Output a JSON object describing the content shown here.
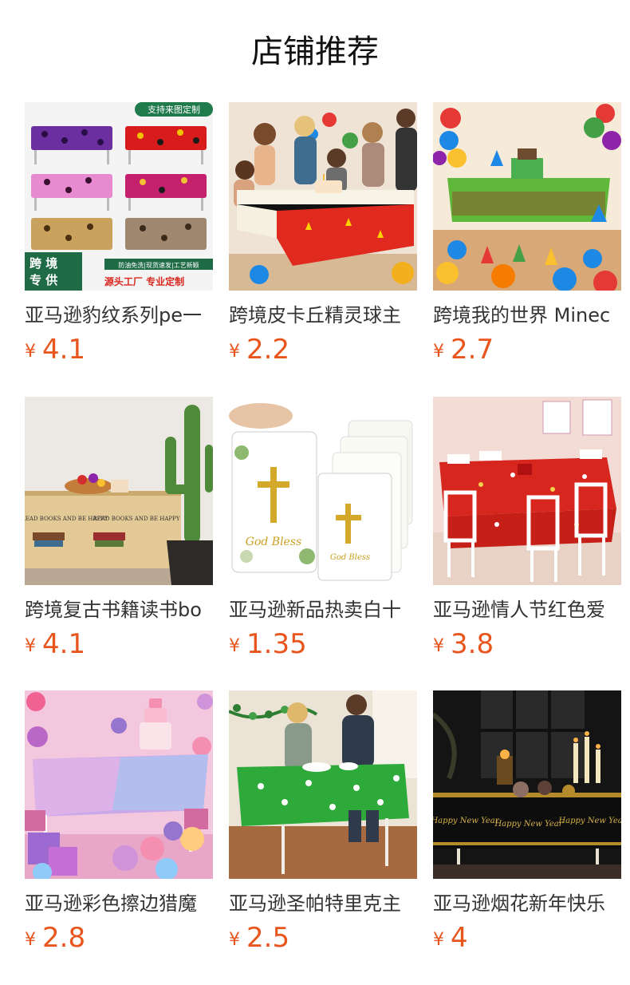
{
  "page": {
    "title": "店铺推荐"
  },
  "products": [
    {
      "name": "亚马逊豹纹系列pe一",
      "currency": "¥",
      "price": "4.1",
      "image_text": {
        "top_badge": "支持来图定制",
        "corner_label_1": "跨 境",
        "corner_label_2": "专 供",
        "features": "防油免洗|现货速发|工艺新颖",
        "slogan": "源头工厂  专业定制"
      }
    },
    {
      "name": "跨境皮卡丘精灵球主",
      "currency": "¥",
      "price": "2.2"
    },
    {
      "name": "跨境我的世界 Minec",
      "currency": "¥",
      "price": "2.7"
    },
    {
      "name": "跨境复古书籍读书bo",
      "currency": "¥",
      "price": "4.1",
      "image_text": {
        "banner": "READ BOOKS AND BE HAPPY"
      }
    },
    {
      "name": "亚马逊新品热卖白十",
      "currency": "¥",
      "price": "1.35",
      "image_text": {
        "script": "God Bless"
      }
    },
    {
      "name": "亚马逊情人节红色爱",
      "currency": "¥",
      "price": "3.8"
    },
    {
      "name": "亚马逊彩色擦边猎魔",
      "currency": "¥",
      "price": "2.8"
    },
    {
      "name": "亚马逊圣帕特里克主",
      "currency": "¥",
      "price": "2.5"
    },
    {
      "name": "亚马逊烟花新年快乐",
      "currency": "¥",
      "price": "4",
      "image_text": {
        "script": "Happy New Year"
      }
    }
  ]
}
